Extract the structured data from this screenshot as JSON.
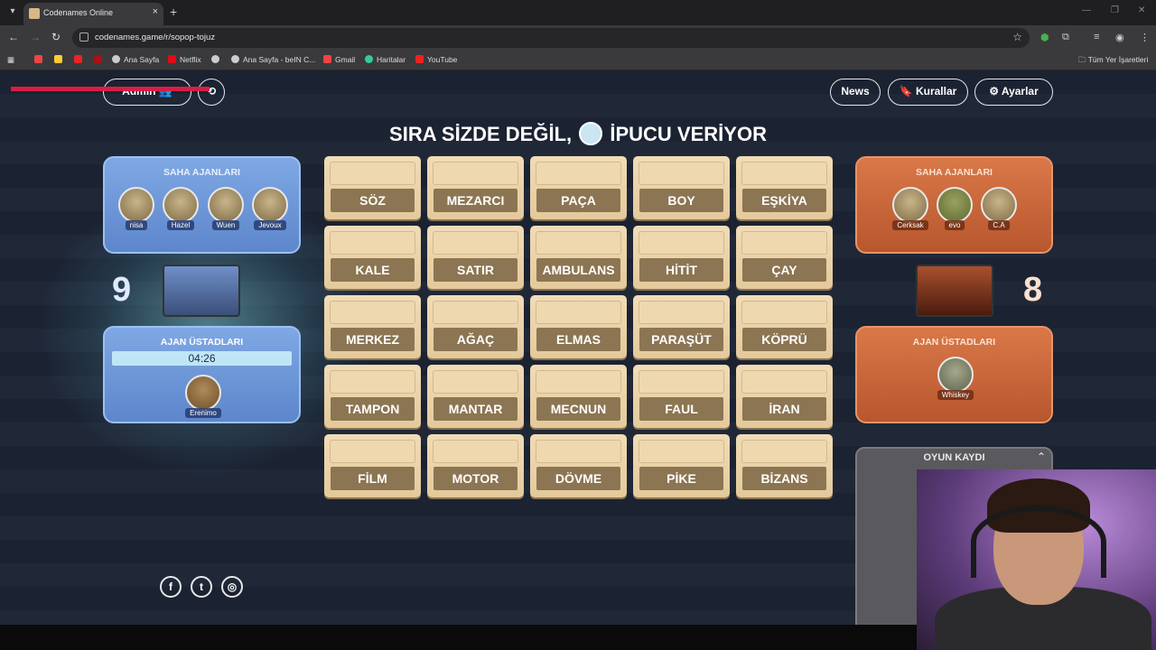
{
  "browser": {
    "tab_title": "Codenames Online",
    "url": "codenames.game/r/sopop-tojuz",
    "bookmarks": [
      "Ana Sayfa",
      "Netflix",
      "Ana Sayfa - beIN C...",
      "Gmail",
      "Haritalar",
      "YouTube"
    ],
    "all_bookmarks": "Tüm Yer İşaretleri"
  },
  "header": {
    "admin_label": "Admin",
    "news_label": "News",
    "rules_label": "Kurallar",
    "settings_label": "Ayarlar"
  },
  "turn_message": {
    "part1": "SIRA SİZDE DEĞİL,",
    "part2": "İPUCU VERİYOR"
  },
  "blue_team": {
    "operatives_title": "SAHA AJANLARI",
    "operatives": [
      "nisa",
      "Hazel",
      "Wuen",
      "Jevoux"
    ],
    "score": "9",
    "spymasters_title": "AJAN ÜSTADLARI",
    "timer": "04:26",
    "spymasters": [
      "Erenimo"
    ],
    "color": "#6f98da"
  },
  "red_team": {
    "operatives_title": "SAHA AJANLARI",
    "operatives": [
      "Cerksak",
      "evo",
      "C.A"
    ],
    "score": "8",
    "spymasters_title": "AJAN ÜSTADLARI",
    "spymasters": [
      "Whiskey"
    ],
    "color": "#c8643a"
  },
  "board": {
    "words": [
      "SÖZ",
      "MEZARCI",
      "PAÇA",
      "BOY",
      "EŞKİYA",
      "KALE",
      "SATIR",
      "AMBULANS",
      "HİTİT",
      "ÇAY",
      "MERKEZ",
      "AĞAÇ",
      "ELMAS",
      "PARAŞÜT",
      "KÖPRÜ",
      "TAMPON",
      "MANTAR",
      "MECNUN",
      "FAUL",
      "İRAN",
      "FİLM",
      "MOTOR",
      "DÖVME",
      "PİKE",
      "BİZANS"
    ]
  },
  "log": {
    "title": "OYUN KAYDI"
  },
  "social": [
    "facebook-icon",
    "twitter-icon",
    "instagram-icon"
  ]
}
